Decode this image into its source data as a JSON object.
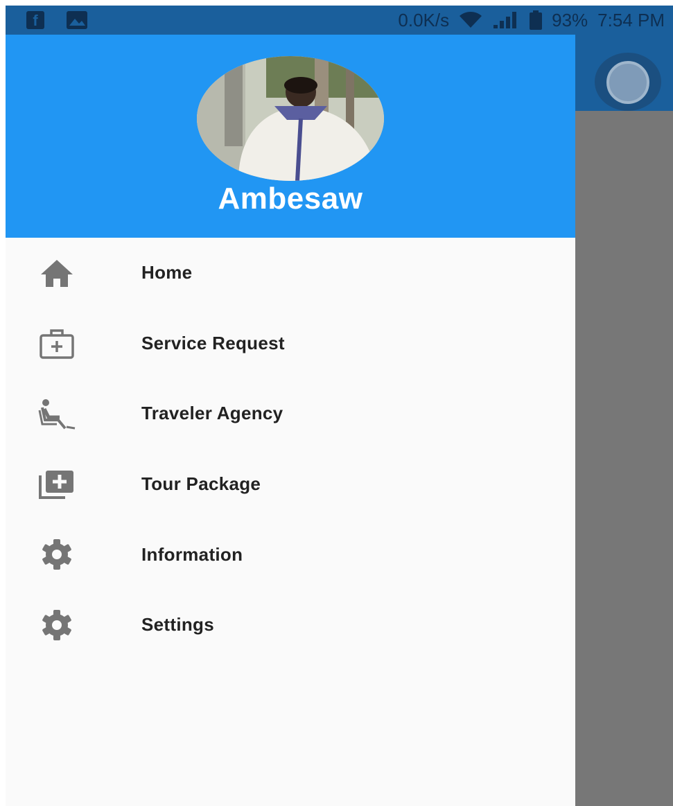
{
  "status_bar": {
    "left_icons": [
      "facebook-icon",
      "gallery-icon"
    ],
    "network_speed": "0.0K/s",
    "icons": [
      "wifi-icon",
      "signal-icon",
      "battery-icon"
    ],
    "battery": "93%",
    "time": "7:54 PM"
  },
  "drawer": {
    "user_name": "Ambesaw",
    "items": [
      {
        "label": "Home",
        "icon": "home-icon"
      },
      {
        "label": "Service Request",
        "icon": "medical-bag-icon"
      },
      {
        "label": "Traveler Agency",
        "icon": "seat-recline-icon"
      },
      {
        "label": "Tour Package",
        "icon": "library-add-icon"
      },
      {
        "label": "Information",
        "icon": "gear-icon"
      },
      {
        "label": "Settings",
        "icon": "gear-icon"
      }
    ]
  },
  "colors": {
    "header": "#2196f3",
    "status_bar": "#1a5f9c",
    "drawer_bg": "#fafafa",
    "scrim": "#777777",
    "icon": "#757575",
    "text": "#222222"
  }
}
